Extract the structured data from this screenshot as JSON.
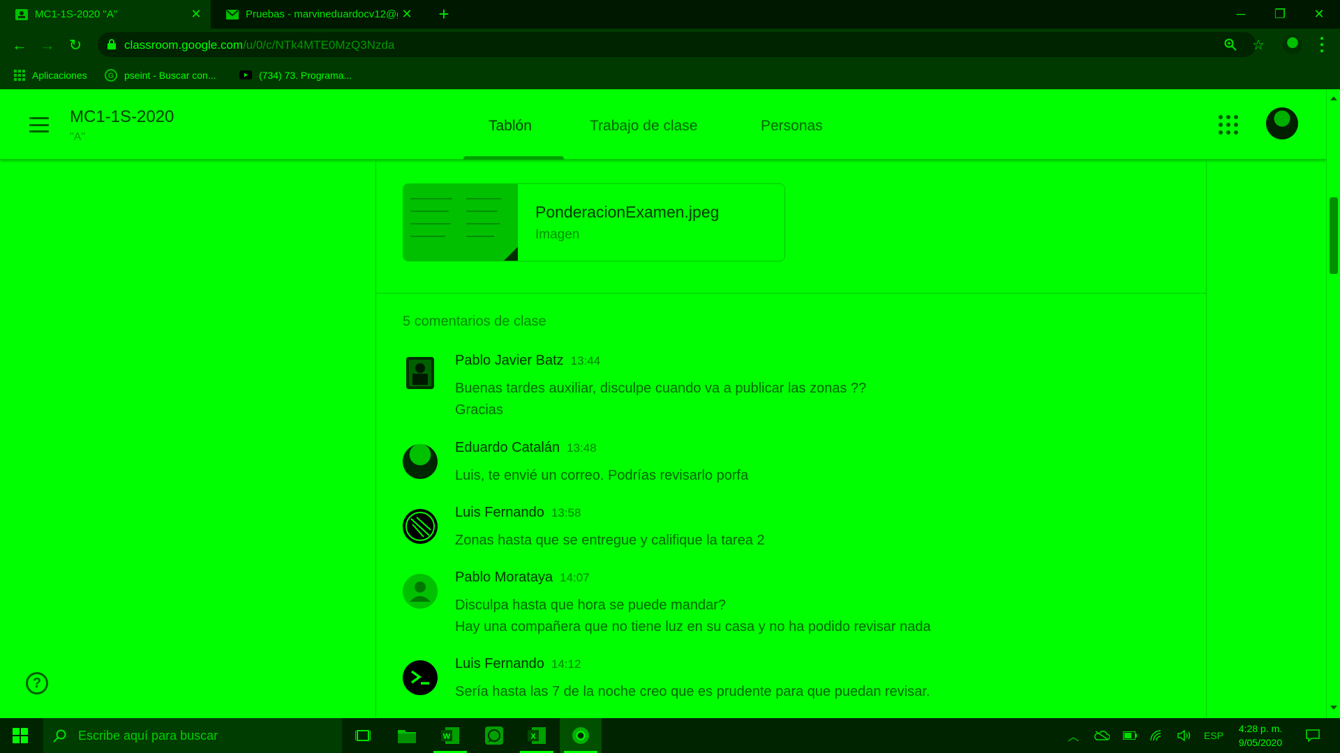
{
  "browser": {
    "tabs": [
      {
        "title": "MC1-1S-2020 \"A\"",
        "active": true,
        "icon": "classroom-icon"
      },
      {
        "title": "Pruebas - marvineduardocv12@g",
        "active": false,
        "icon": "gmail-icon"
      }
    ],
    "url_host": "classroom.google.com",
    "url_path": "/u/0/c/NTk4MTE0MzQ3Nzda",
    "bookmarks": [
      {
        "label": "Aplicaciones",
        "icon": "apps-grid-icon"
      },
      {
        "label": "pseint - Buscar con...",
        "icon": "google-icon"
      },
      {
        "label": "(734) 73. Programa...",
        "icon": "youtube-icon"
      }
    ]
  },
  "classroom": {
    "course_title": "MC1-1S-2020",
    "course_section": "\"A\"",
    "tabs": [
      {
        "label": "Tablón",
        "active": true
      },
      {
        "label": "Trabajo de clase",
        "active": false
      },
      {
        "label": "Personas",
        "active": false
      }
    ]
  },
  "post": {
    "attachment": {
      "filename": "PonderacionExamen.jpeg",
      "type": "Imagen"
    },
    "comments_title": "5 comentarios de clase",
    "comments": [
      {
        "author": "Pablo Javier Batz",
        "time": "13:44",
        "lines": [
          "Buenas tardes auxiliar, disculpe cuando va a publicar las zonas ??",
          "Gracias"
        ],
        "avatar": "photo-avatar"
      },
      {
        "author": "Eduardo Catalán",
        "time": "13:48",
        "lines": [
          "Luis, te envié un correo. Podrías revisarlo porfa"
        ],
        "avatar": "landscape-avatar"
      },
      {
        "author": "Luis Fernando",
        "time": "13:58",
        "lines": [
          "Zonas hasta que se entregue y califique la tarea 2"
        ],
        "avatar": "logo-avatar"
      },
      {
        "author": "Pablo Morataya",
        "time": "14:07",
        "lines": [
          "Disculpa hasta que hora se puede mandar?",
          "Hay una compañera que no tiene luz en su casa y no ha podido revisar nada"
        ],
        "avatar": "default-person-avatar"
      },
      {
        "author": "Luis Fernando",
        "time": "14:12",
        "lines": [
          "Sería hasta las 7 de la noche creo que es prudente para que puedan revisar."
        ],
        "avatar": "terminal-avatar"
      }
    ]
  },
  "taskbar": {
    "search_placeholder": "Escribe aquí para buscar",
    "language": "ESP",
    "time": "4:28 p. m.",
    "date": "9/05/2020"
  },
  "colors": {
    "background": "#00ff00",
    "chrome_dark": "#001800",
    "chrome_bar": "#003a00",
    "taskbar": "#002400"
  }
}
